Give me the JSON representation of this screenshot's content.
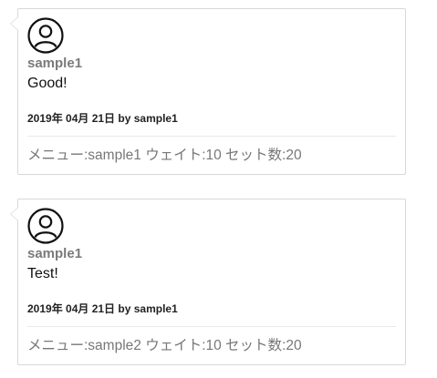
{
  "posts": [
    {
      "username": "sample1",
      "comment": "Good!",
      "meta": "2019年 04月 21日 by sample1",
      "workout": "メニュー:sample1 ウェイト:10 セット数:20"
    },
    {
      "username": "sample1",
      "comment": "Test!",
      "meta": "2019年 04月 21日 by sample1",
      "workout": "メニュー:sample2 ウェイト:10 セット数:20"
    }
  ],
  "icons": {
    "avatar": "user-avatar-icon"
  },
  "colors": {
    "border": "#d8d8d8",
    "username": "#7a7a7a",
    "workout_text": "#777777"
  }
}
